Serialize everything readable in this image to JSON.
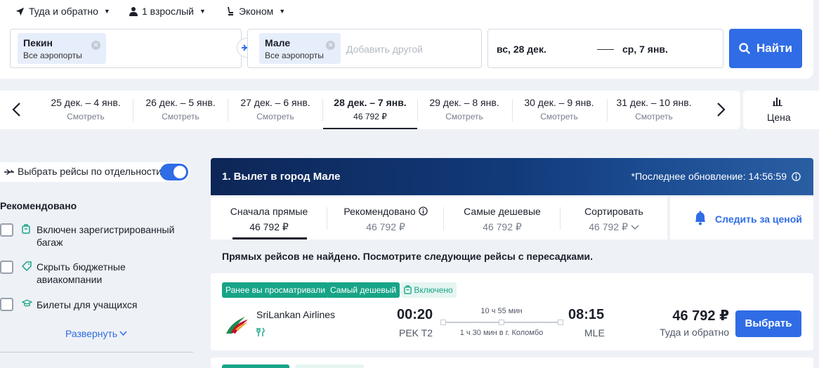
{
  "search": {
    "trip_type": "Туда и обратно",
    "passengers": "1 взрослый",
    "cabin": "Эконом",
    "origin": {
      "city": "Пекин",
      "airports": "Все аэропорты"
    },
    "destination": {
      "city": "Мале",
      "airports": "Все аэропорты"
    },
    "add_another_placeholder": "Добавить другой",
    "depart_date": "вс, 28 дек.",
    "return_date": "ср, 7 янв.",
    "find_label": "Найти"
  },
  "date_strip": {
    "items": [
      {
        "range": "25 дек. – 4 янв.",
        "sub": "Смотреть",
        "selected": false
      },
      {
        "range": "26 дек. – 5 янв.",
        "sub": "Смотреть",
        "selected": false
      },
      {
        "range": "27 дек. – 6 янв.",
        "sub": "Смотреть",
        "selected": false
      },
      {
        "range": "28 дек. – 7 янв.",
        "sub": "46 792 ₽",
        "selected": true
      },
      {
        "range": "29 дек. – 8 янв.",
        "sub": "Смотреть",
        "selected": false
      },
      {
        "range": "30 дек. – 9 янв.",
        "sub": "Смотреть",
        "selected": false
      },
      {
        "range": "31 дек. – 10 янв.",
        "sub": "Смотреть",
        "selected": false
      }
    ],
    "price_label": "Цена"
  },
  "sidebar": {
    "separate_toggle_label": "Выбрать рейсы по отдельности",
    "separate_toggle_on": true,
    "recommended_title": "Рекомендовано",
    "filters": [
      {
        "line1": "Включен зарегистрированный",
        "line2": "багаж",
        "icon": "luggage-icon"
      },
      {
        "line1": "Скрыть бюджетные",
        "line2": "авиакомпании",
        "icon": "tag-icon"
      },
      {
        "line1": "Билеты для учащихся",
        "line2": "",
        "icon": "graduation-cap-icon"
      }
    ],
    "expand_label": "Развернуть"
  },
  "results": {
    "section_title": "1. Вылет в город Мале",
    "last_update": "*Последнее обновление: 14:56:59",
    "sort_tabs": [
      {
        "label": "Сначала прямые",
        "price": "46 792 ₽",
        "selected": true
      },
      {
        "label": "Рекомендовано",
        "price": "46 792 ₽",
        "selected": false
      },
      {
        "label": "Самые дешевые",
        "price": "46 792 ₽",
        "selected": false
      },
      {
        "label": "Сортировать",
        "price": "46 792 ₽",
        "selected": false
      }
    ],
    "price_alert_label": "Следить за ценой",
    "no_direct_msg": "Прямых рейсов не найдено. Посмотрите следующие рейсы с пересадками.",
    "flight": {
      "tags": [
        "Ранее вы просматривали",
        "Самый дешевый",
        "Включено"
      ],
      "airline": "SriLankan Airlines",
      "depart_time": "00:20",
      "depart_airport": "PEK T2",
      "duration": "10 ч 55 мин",
      "stops": "1 ч 30 мин в г. Коломбо",
      "arrive_time": "08:15",
      "arrive_airport": "MLE",
      "price": "46 792 ₽",
      "price_note": "Туда и обратно",
      "select_label": "Выбрать"
    }
  },
  "colors": {
    "accent": "#2f6ce5",
    "teal": "#17a487",
    "header_dark": "#0d2657"
  }
}
